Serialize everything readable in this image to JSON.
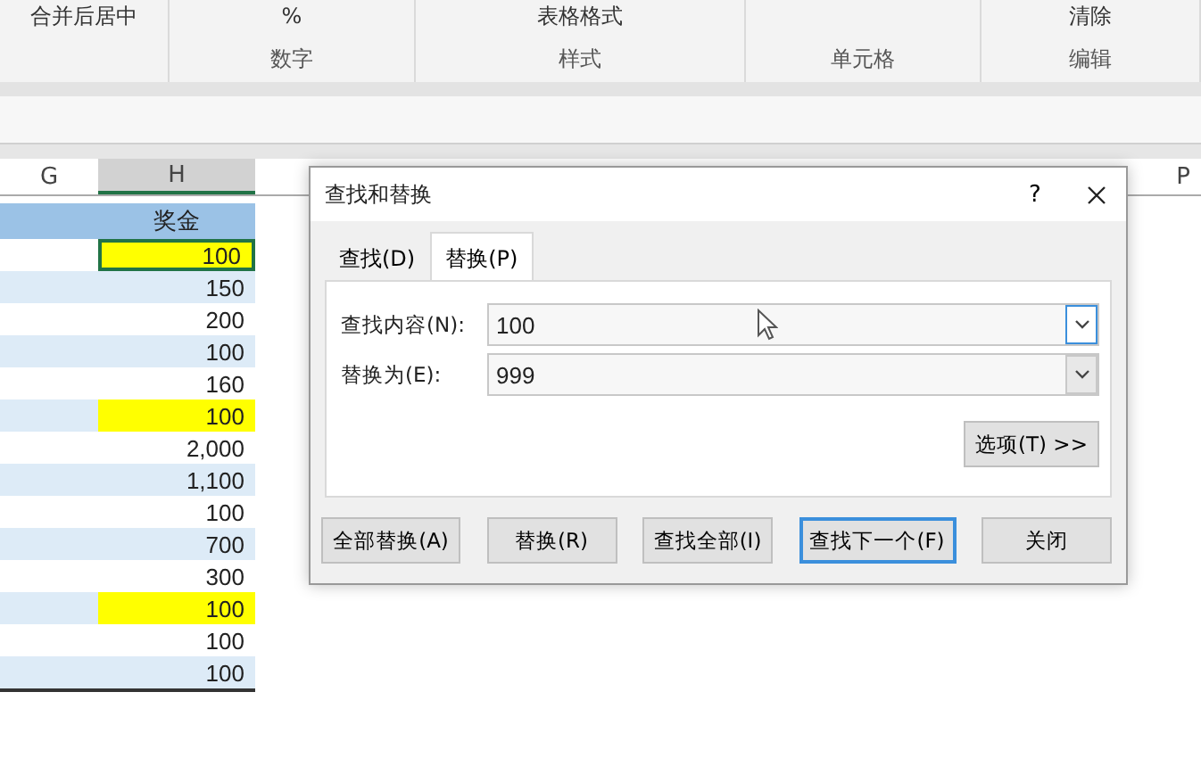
{
  "ribbon": {
    "groups": [
      {
        "items": [
          "合并后居中"
        ]
      },
      {
        "label": "数字",
        "items": [
          "%"
        ]
      },
      {
        "label": "样式",
        "items": [
          "表格格式"
        ]
      },
      {
        "label": "单元格"
      },
      {
        "label": "编辑",
        "items": [
          "清除"
        ]
      }
    ]
  },
  "sheet": {
    "columns": [
      {
        "letter": "G",
        "selected": false
      },
      {
        "letter": "H",
        "selected": true
      },
      {
        "letter": "P",
        "selected": false
      }
    ],
    "header": "奖金",
    "rows": [
      {
        "value": "100",
        "highlighted": true,
        "selected": true
      },
      {
        "value": "150",
        "highlighted": false,
        "selected": false
      },
      {
        "value": "200",
        "highlighted": false,
        "selected": false
      },
      {
        "value": "100",
        "highlighted": false,
        "selected": false
      },
      {
        "value": "160",
        "highlighted": false,
        "selected": false
      },
      {
        "value": "100",
        "highlighted": true,
        "selected": false
      },
      {
        "value": "2,000",
        "highlighted": false,
        "selected": false
      },
      {
        "value": "1,100",
        "highlighted": false,
        "selected": false
      },
      {
        "value": "100",
        "highlighted": false,
        "selected": false
      },
      {
        "value": "700",
        "highlighted": false,
        "selected": false
      },
      {
        "value": "300",
        "highlighted": false,
        "selected": false
      },
      {
        "value": "100",
        "highlighted": true,
        "selected": false
      },
      {
        "value": "100",
        "highlighted": false,
        "selected": false
      },
      {
        "value": "100",
        "highlighted": false,
        "selected": false
      }
    ]
  },
  "dialog": {
    "title": "查找和替换",
    "help": "?",
    "tabs": [
      {
        "label": "查找(D)",
        "selected": false
      },
      {
        "label": "替换(P)",
        "selected": true
      }
    ],
    "fields": [
      {
        "label": "查找内容(N):",
        "value": "100",
        "focused": true
      },
      {
        "label": "替换为(E):",
        "value": "999",
        "focused": false
      }
    ],
    "options_button": "选项(T) >>",
    "buttons": [
      {
        "label": "全部替换(A)",
        "default": false
      },
      {
        "label": "替换(R)",
        "default": false
      },
      {
        "label": "查找全部(I)",
        "default": false
      },
      {
        "label": "查找下一个(F)",
        "default": true
      },
      {
        "label": "关闭",
        "default": false
      }
    ]
  }
}
